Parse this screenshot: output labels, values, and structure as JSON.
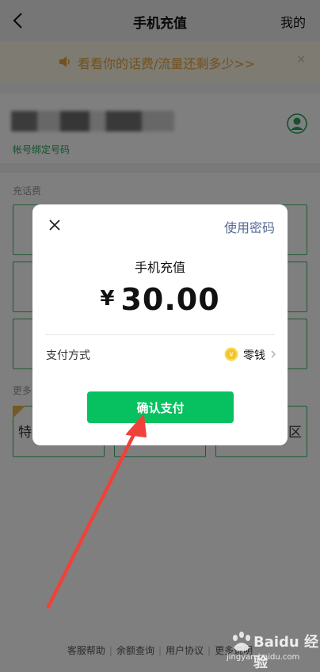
{
  "header": {
    "title": "手机充值",
    "right_link": "我的",
    "back_icon": "chevron-left-icon"
  },
  "notice": {
    "text": "看看你的话费/流量还剩多少>>",
    "close": "×",
    "color": "#e6a23c"
  },
  "account": {
    "bind_label": "帐号绑定号码",
    "avatar_icon": "user-circle-icon"
  },
  "sections": {
    "recharge_label": "充话费",
    "more_label": "更多",
    "promo_visible_text": "特",
    "region_visible_text": "区"
  },
  "footer": {
    "links": [
      "客服帮助",
      "余额查询",
      "用户协议",
      "更多说明"
    ]
  },
  "dialog": {
    "close_icon": "close-icon",
    "use_password": "使用密码",
    "title": "手机充值",
    "currency": "¥",
    "amount": "30.00",
    "payment_method_label": "支付方式",
    "payment_method_value": "零钱",
    "payment_icon": "coin-icon",
    "confirm_button": "确认支付"
  },
  "colors": {
    "accent_green": "#07c160",
    "link_blue": "#576b95",
    "annotation_red": "#f0413a"
  },
  "watermark": {
    "text": "Baidu 经验",
    "url": "jingyan.baidu.com"
  }
}
